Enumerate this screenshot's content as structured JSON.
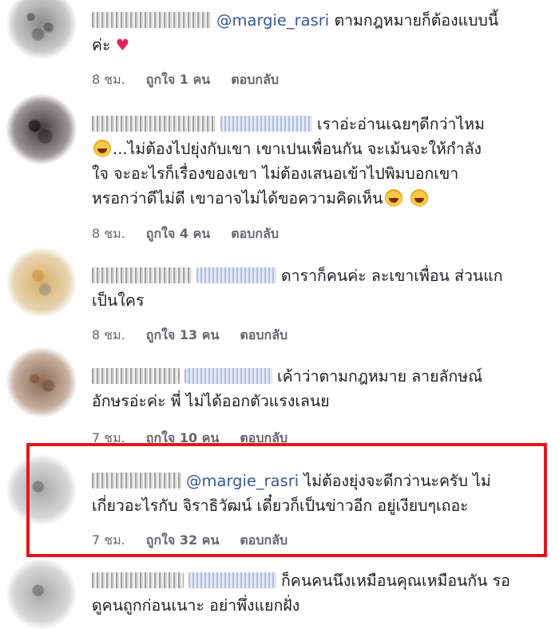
{
  "comments": [
    {
      "mention": "@margie_rasri",
      "text1": "ตามกฎหมายก็ต้องแบบนี้",
      "text2": "ค่ะ",
      "time": "8 ชม.",
      "likes": "ถูกใจ 1 คน",
      "reply": "ตอบกลับ"
    },
    {
      "text1": "เราอ่ะอ่านเฉยๆดีกว่าไหม",
      "text2": "...ไม่ต้องไปยุ่งกับเขา เขาเปนเพื่อนกัน จะเม้นจะให้กำลัง",
      "text3": "ใจ จะอะไรก็เรื่องของเขา ไม่ต้องเสนอเข้าไปพิมบอกเขา",
      "text4": "หรอกว่าดีไม่ดี เขาอาจไม่ได้ขอความคิดเห็น",
      "time": "8 ชม.",
      "likes": "ถูกใจ 4 คน",
      "reply": "ตอบกลับ"
    },
    {
      "text1": "ดาราก็คนค่ะ ละเขาเพื่อน ส่วนแก",
      "text2": "เป็นใคร",
      "time": "8 ชม.",
      "likes": "ถูกใจ 13 คน",
      "reply": "ตอบกลับ"
    },
    {
      "text1": "เค้าว่าตามกฎหมาย ลายลักษณ์",
      "text2": "อักษรอ่ะค่ะ พี่ ไม่ได้ออกตัวแรงเลนย",
      "time": "7 ชม.",
      "likes": "ถูกใจ 10 คน",
      "reply": "ตอบกลับ"
    },
    {
      "mention": "@margie_rasri",
      "text1": "ไม่ต้องยุ่งจะดีกว่านะครับ ไม่",
      "text2": "เกี่ยวอะไรกับ จิราธิวัฒน์ เดี๋ยวก็เป็นข่าวอีก อยู่เงียบๆเถอะ",
      "time": "7 ชม.",
      "likes": "ถูกใจ 32 คน",
      "reply": "ตอบกลับ"
    },
    {
      "text1": "ก็คนคนนึงเหมือนคุณเหมือนกัน รอ",
      "text2": "ดูคนถูกก่อนเนาะ อย่าพึ่งแยกฝั่ง"
    }
  ],
  "colors": {
    "highlight": "#e4161b",
    "link": "#385898",
    "meta": "#65676b"
  }
}
